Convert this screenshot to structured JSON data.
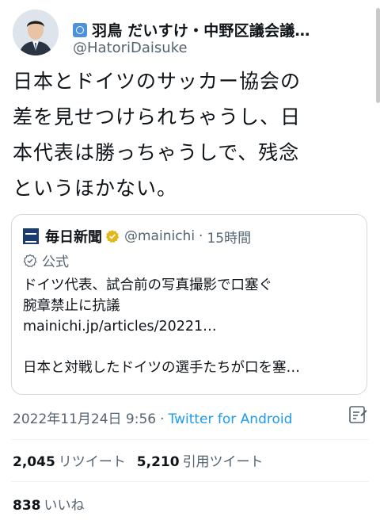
{
  "author": {
    "display_name": "羽鳥 だいすけ・中野区議会議…",
    "handle": "@HatoriDaisuke",
    "badge_icon": "un-flag-icon"
  },
  "tweet": {
    "text": "日本とドイツのサッカー協会の\n差を見せつけられちゃうし、日\n本代表は勝っちゃうしで、残念\nというほかない。"
  },
  "quote": {
    "name": "毎日新聞",
    "handle": "@mainichi",
    "separator": "·",
    "time": "15時間",
    "official_label": "公式",
    "body": "ドイツ代表、試合前の写真撮影で口塞ぐ\n腕章禁止に抗議\nmainichi.jp/articles/20221…\n\n日本と対戦したドイツの選手たちが口を塞…",
    "verified_color": "#e2b719",
    "logo_color": "#1d3c6e"
  },
  "meta": {
    "timestamp": "2022年11月24日 9:56",
    "separator": "·",
    "source": "Twitter for Android"
  },
  "stats": {
    "retweets": "2,045",
    "retweets_label": "リツイート",
    "quotes": "5,210",
    "quotes_label": "引用ツイート",
    "likes": "838",
    "likes_label": "いいね"
  },
  "colors": {
    "link": "#1d9bf0",
    "secondary_text": "#536471",
    "border": "#cfd9de"
  }
}
